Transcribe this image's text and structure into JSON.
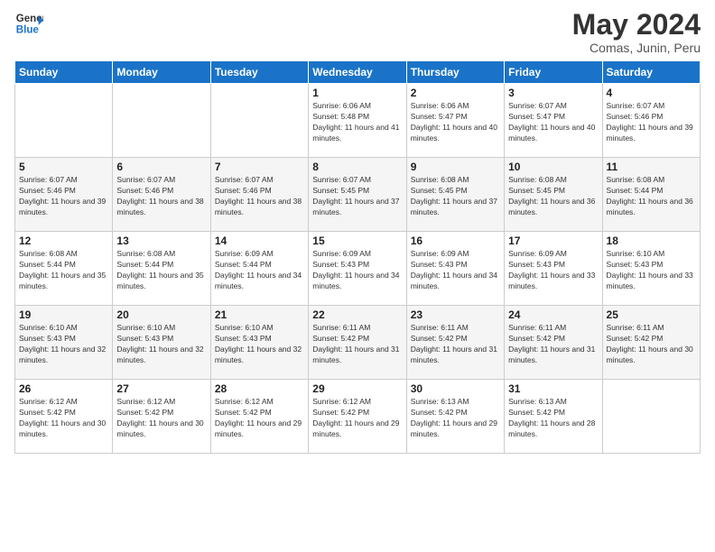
{
  "header": {
    "logo_line1": "General",
    "logo_line2": "Blue",
    "month_title": "May 2024",
    "subtitle": "Comas, Junin, Peru"
  },
  "days_of_week": [
    "Sunday",
    "Monday",
    "Tuesday",
    "Wednesday",
    "Thursday",
    "Friday",
    "Saturday"
  ],
  "weeks": [
    [
      {
        "day": "",
        "sunrise": "",
        "sunset": "",
        "daylight": ""
      },
      {
        "day": "",
        "sunrise": "",
        "sunset": "",
        "daylight": ""
      },
      {
        "day": "",
        "sunrise": "",
        "sunset": "",
        "daylight": ""
      },
      {
        "day": "1",
        "sunrise": "Sunrise: 6:06 AM",
        "sunset": "Sunset: 5:48 PM",
        "daylight": "Daylight: 11 hours and 41 minutes."
      },
      {
        "day": "2",
        "sunrise": "Sunrise: 6:06 AM",
        "sunset": "Sunset: 5:47 PM",
        "daylight": "Daylight: 11 hours and 40 minutes."
      },
      {
        "day": "3",
        "sunrise": "Sunrise: 6:07 AM",
        "sunset": "Sunset: 5:47 PM",
        "daylight": "Daylight: 11 hours and 40 minutes."
      },
      {
        "day": "4",
        "sunrise": "Sunrise: 6:07 AM",
        "sunset": "Sunset: 5:46 PM",
        "daylight": "Daylight: 11 hours and 39 minutes."
      }
    ],
    [
      {
        "day": "5",
        "sunrise": "Sunrise: 6:07 AM",
        "sunset": "Sunset: 5:46 PM",
        "daylight": "Daylight: 11 hours and 39 minutes."
      },
      {
        "day": "6",
        "sunrise": "Sunrise: 6:07 AM",
        "sunset": "Sunset: 5:46 PM",
        "daylight": "Daylight: 11 hours and 38 minutes."
      },
      {
        "day": "7",
        "sunrise": "Sunrise: 6:07 AM",
        "sunset": "Sunset: 5:46 PM",
        "daylight": "Daylight: 11 hours and 38 minutes."
      },
      {
        "day": "8",
        "sunrise": "Sunrise: 6:07 AM",
        "sunset": "Sunset: 5:45 PM",
        "daylight": "Daylight: 11 hours and 37 minutes."
      },
      {
        "day": "9",
        "sunrise": "Sunrise: 6:08 AM",
        "sunset": "Sunset: 5:45 PM",
        "daylight": "Daylight: 11 hours and 37 minutes."
      },
      {
        "day": "10",
        "sunrise": "Sunrise: 6:08 AM",
        "sunset": "Sunset: 5:45 PM",
        "daylight": "Daylight: 11 hours and 36 minutes."
      },
      {
        "day": "11",
        "sunrise": "Sunrise: 6:08 AM",
        "sunset": "Sunset: 5:44 PM",
        "daylight": "Daylight: 11 hours and 36 minutes."
      }
    ],
    [
      {
        "day": "12",
        "sunrise": "Sunrise: 6:08 AM",
        "sunset": "Sunset: 5:44 PM",
        "daylight": "Daylight: 11 hours and 35 minutes."
      },
      {
        "day": "13",
        "sunrise": "Sunrise: 6:08 AM",
        "sunset": "Sunset: 5:44 PM",
        "daylight": "Daylight: 11 hours and 35 minutes."
      },
      {
        "day": "14",
        "sunrise": "Sunrise: 6:09 AM",
        "sunset": "Sunset: 5:44 PM",
        "daylight": "Daylight: 11 hours and 34 minutes."
      },
      {
        "day": "15",
        "sunrise": "Sunrise: 6:09 AM",
        "sunset": "Sunset: 5:43 PM",
        "daylight": "Daylight: 11 hours and 34 minutes."
      },
      {
        "day": "16",
        "sunrise": "Sunrise: 6:09 AM",
        "sunset": "Sunset: 5:43 PM",
        "daylight": "Daylight: 11 hours and 34 minutes."
      },
      {
        "day": "17",
        "sunrise": "Sunrise: 6:09 AM",
        "sunset": "Sunset: 5:43 PM",
        "daylight": "Daylight: 11 hours and 33 minutes."
      },
      {
        "day": "18",
        "sunrise": "Sunrise: 6:10 AM",
        "sunset": "Sunset: 5:43 PM",
        "daylight": "Daylight: 11 hours and 33 minutes."
      }
    ],
    [
      {
        "day": "19",
        "sunrise": "Sunrise: 6:10 AM",
        "sunset": "Sunset: 5:43 PM",
        "daylight": "Daylight: 11 hours and 32 minutes."
      },
      {
        "day": "20",
        "sunrise": "Sunrise: 6:10 AM",
        "sunset": "Sunset: 5:43 PM",
        "daylight": "Daylight: 11 hours and 32 minutes."
      },
      {
        "day": "21",
        "sunrise": "Sunrise: 6:10 AM",
        "sunset": "Sunset: 5:43 PM",
        "daylight": "Daylight: 11 hours and 32 minutes."
      },
      {
        "day": "22",
        "sunrise": "Sunrise: 6:11 AM",
        "sunset": "Sunset: 5:42 PM",
        "daylight": "Daylight: 11 hours and 31 minutes."
      },
      {
        "day": "23",
        "sunrise": "Sunrise: 6:11 AM",
        "sunset": "Sunset: 5:42 PM",
        "daylight": "Daylight: 11 hours and 31 minutes."
      },
      {
        "day": "24",
        "sunrise": "Sunrise: 6:11 AM",
        "sunset": "Sunset: 5:42 PM",
        "daylight": "Daylight: 11 hours and 31 minutes."
      },
      {
        "day": "25",
        "sunrise": "Sunrise: 6:11 AM",
        "sunset": "Sunset: 5:42 PM",
        "daylight": "Daylight: 11 hours and 30 minutes."
      }
    ],
    [
      {
        "day": "26",
        "sunrise": "Sunrise: 6:12 AM",
        "sunset": "Sunset: 5:42 PM",
        "daylight": "Daylight: 11 hours and 30 minutes."
      },
      {
        "day": "27",
        "sunrise": "Sunrise: 6:12 AM",
        "sunset": "Sunset: 5:42 PM",
        "daylight": "Daylight: 11 hours and 30 minutes."
      },
      {
        "day": "28",
        "sunrise": "Sunrise: 6:12 AM",
        "sunset": "Sunset: 5:42 PM",
        "daylight": "Daylight: 11 hours and 29 minutes."
      },
      {
        "day": "29",
        "sunrise": "Sunrise: 6:12 AM",
        "sunset": "Sunset: 5:42 PM",
        "daylight": "Daylight: 11 hours and 29 minutes."
      },
      {
        "day": "30",
        "sunrise": "Sunrise: 6:13 AM",
        "sunset": "Sunset: 5:42 PM",
        "daylight": "Daylight: 11 hours and 29 minutes."
      },
      {
        "day": "31",
        "sunrise": "Sunrise: 6:13 AM",
        "sunset": "Sunset: 5:42 PM",
        "daylight": "Daylight: 11 hours and 28 minutes."
      },
      {
        "day": "",
        "sunrise": "",
        "sunset": "",
        "daylight": ""
      }
    ]
  ]
}
